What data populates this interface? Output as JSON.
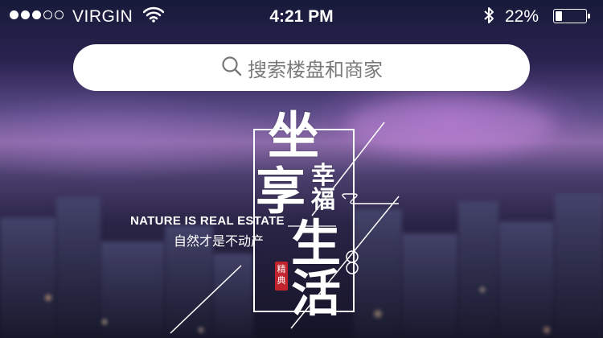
{
  "status_bar": {
    "carrier": "VIRGIN",
    "signal_bars_filled": 3,
    "signal_bars_total": 5,
    "time": "4:21 PM",
    "battery_percent": "22%",
    "battery_level": 0.22
  },
  "search": {
    "placeholder": "搜索楼盘和商家",
    "icon": "search-icon"
  },
  "poster": {
    "char_1": "坐",
    "char_2": "享",
    "char_3": "幸",
    "char_4": "福",
    "char_5": "生",
    "char_6": "活",
    "tagline_en": "NATURE IS REAL ESTATE",
    "tagline_cn": "自然才是不动产",
    "seal_line1": "精",
    "seal_line2": "典"
  },
  "colors": {
    "search_bg": "#ffffff",
    "seal": "#c0232c",
    "text": "#ffffff"
  }
}
